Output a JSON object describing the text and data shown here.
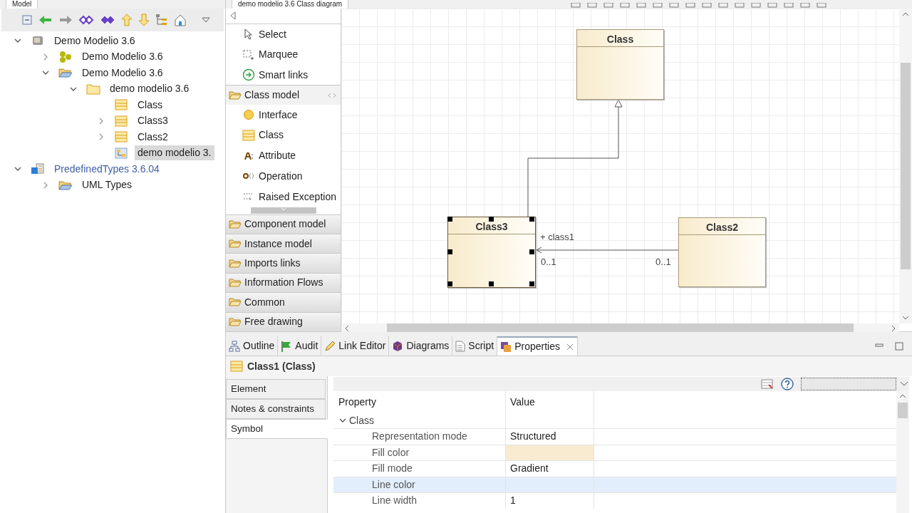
{
  "model_view": {
    "tab": "Model",
    "tree": [
      {
        "label": "Demo Modelio 3.6",
        "kind": "project",
        "expanded": true,
        "selected": false,
        "children": [
          {
            "label": "Demo Modelio 3.6",
            "kind": "components",
            "expanded": false,
            "selected": false
          },
          {
            "label": "Demo Modelio 3.6",
            "kind": "open-folder",
            "expanded": true,
            "selected": false,
            "children": [
              {
                "label": "demo modelio 3.6",
                "kind": "package",
                "expanded": true,
                "selected": false,
                "children": [
                  {
                    "label": "Class",
                    "kind": "class",
                    "selected": false
                  },
                  {
                    "label": "Class3",
                    "kind": "class",
                    "expanded": false,
                    "selected": false
                  },
                  {
                    "label": "Class2",
                    "kind": "class",
                    "expanded": false,
                    "selected": false
                  },
                  {
                    "label": "demo modelio 3.",
                    "kind": "diagram",
                    "selected": true
                  }
                ]
              }
            ]
          }
        ]
      },
      {
        "label": "PredefinedTypes 3.6.04",
        "kind": "library",
        "expanded": true,
        "selected": false,
        "children": [
          {
            "label": "UML Types",
            "kind": "open-folder",
            "expanded": false,
            "selected": false
          }
        ]
      }
    ]
  },
  "diagram_editor": {
    "tab": "demo modelio 3.6 Class diagram",
    "palette": {
      "tools": [
        {
          "label": "Select",
          "kind": "pointer"
        },
        {
          "label": "Marquee",
          "kind": "marquee"
        },
        {
          "label": "Smart links",
          "kind": "smart"
        }
      ],
      "groups": [
        {
          "label": "Class model",
          "expanded": true,
          "items": [
            {
              "label": "Interface",
              "kind": "interface"
            },
            {
              "label": "Class",
              "kind": "class"
            },
            {
              "label": "Attribute",
              "kind": "attribute"
            },
            {
              "label": "Operation",
              "kind": "operation"
            },
            {
              "label": "Raised Exception",
              "kind": "exception"
            }
          ]
        },
        {
          "label": "Component model",
          "expanded": false
        },
        {
          "label": "Instance model",
          "expanded": false
        },
        {
          "label": "Imports links",
          "expanded": false
        },
        {
          "label": "Information Flows",
          "expanded": false
        },
        {
          "label": "Common",
          "expanded": false
        },
        {
          "label": "Free drawing",
          "expanded": false
        }
      ]
    },
    "classes": [
      {
        "name": "Class",
        "selected": false
      },
      {
        "name": "Class3",
        "selected": true
      },
      {
        "name": "Class2",
        "selected": false
      }
    ],
    "association": {
      "role": "+ class1",
      "source_multiplicity": "0..1",
      "target_multiplicity": "0..1"
    }
  },
  "bottom_panel": {
    "tabs": [
      {
        "label": "Outline",
        "kind": "outline",
        "selected": false
      },
      {
        "label": "Audit",
        "kind": "flag",
        "selected": false
      },
      {
        "label": "Link Editor",
        "kind": "pen",
        "selected": false
      },
      {
        "label": "Diagrams",
        "kind": "cube",
        "selected": false
      },
      {
        "label": "Script",
        "kind": "page",
        "selected": false
      },
      {
        "label": "Properties",
        "kind": "props",
        "selected": true
      }
    ],
    "title": "Class1 (Class)",
    "side_tabs": [
      {
        "label": "Element",
        "selected": false
      },
      {
        "label": "Notes & constraints",
        "selected": false
      },
      {
        "label": "Symbol",
        "selected": true
      }
    ],
    "columns": [
      "Property",
      "Value"
    ],
    "group": {
      "label": "Class",
      "expanded": true
    },
    "rows": [
      {
        "property": "Representation mode",
        "value": "Structured",
        "selected": false
      },
      {
        "property": "Fill color",
        "color": "#f8ebd0",
        "selected": false
      },
      {
        "property": "Fill mode",
        "value": "Gradient",
        "selected": false
      },
      {
        "property": "Line color",
        "selected": true
      },
      {
        "property": "Line width",
        "value": "1",
        "selected": false
      }
    ]
  }
}
